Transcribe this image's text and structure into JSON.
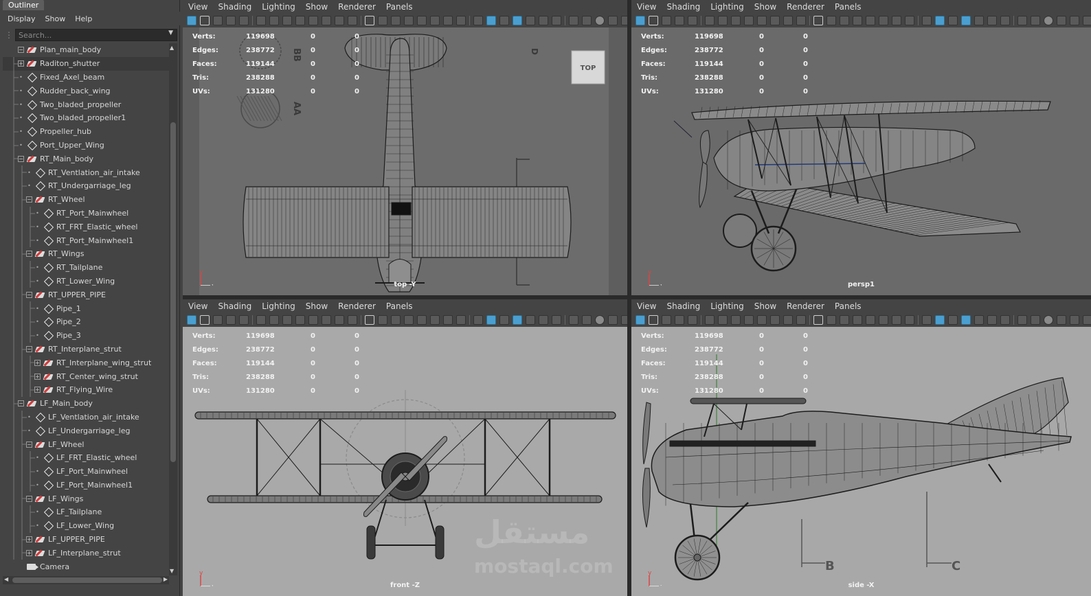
{
  "outliner": {
    "title": "Outliner",
    "menu": [
      "Display",
      "Show",
      "Help"
    ],
    "search_placeholder": "Search...",
    "items": [
      {
        "label": "Plan_main_body",
        "depth": 0,
        "type": "group",
        "expand": "minus"
      },
      {
        "label": "Raditon_shutter",
        "depth": 1,
        "type": "group",
        "expand": "plus",
        "selected": true
      },
      {
        "label": "Fixed_Axel_beam",
        "depth": 1,
        "type": "mesh",
        "expand": "dot"
      },
      {
        "label": "Rudder_back_wing",
        "depth": 1,
        "type": "mesh",
        "expand": "dot"
      },
      {
        "label": "Two_bladed_propeller",
        "depth": 1,
        "type": "mesh",
        "expand": "dot"
      },
      {
        "label": "Two_bladed_propeller1",
        "depth": 1,
        "type": "mesh",
        "expand": "dot"
      },
      {
        "label": "Propeller_hub",
        "depth": 1,
        "type": "mesh",
        "expand": "dot"
      },
      {
        "label": "Port_Upper_Wing",
        "depth": 1,
        "type": "mesh",
        "expand": "dot"
      },
      {
        "label": "RT_Main_body",
        "depth": 1,
        "type": "group",
        "expand": "minus"
      },
      {
        "label": "RT_Ventlation_air_intake",
        "depth": 2,
        "type": "mesh",
        "expand": "dot"
      },
      {
        "label": "RT_Undergarriage_leg",
        "depth": 2,
        "type": "mesh",
        "expand": "dot"
      },
      {
        "label": "RT_Wheel",
        "depth": 2,
        "type": "group",
        "expand": "minus"
      },
      {
        "label": "RT_Port_Mainwheel",
        "depth": 3,
        "type": "mesh",
        "expand": "dot"
      },
      {
        "label": "RT_FRT_Elastic_wheel",
        "depth": 3,
        "type": "mesh",
        "expand": "dot"
      },
      {
        "label": "RT_Port_Mainwheel1",
        "depth": 3,
        "type": "mesh",
        "expand": "dot"
      },
      {
        "label": "RT_Wings",
        "depth": 2,
        "type": "group",
        "expand": "minus"
      },
      {
        "label": "RT_Tailplane",
        "depth": 3,
        "type": "mesh",
        "expand": "dot"
      },
      {
        "label": "RT_Lower_Wing",
        "depth": 3,
        "type": "mesh",
        "expand": "dot"
      },
      {
        "label": "RT_UPPER_PIPE",
        "depth": 2,
        "type": "group",
        "expand": "minus"
      },
      {
        "label": "Pipe_1",
        "depth": 3,
        "type": "mesh",
        "expand": "dot"
      },
      {
        "label": "Pipe_2",
        "depth": 3,
        "type": "mesh",
        "expand": "dot"
      },
      {
        "label": "Pipe_3",
        "depth": 3,
        "type": "mesh",
        "expand": "dot"
      },
      {
        "label": "RT_Interplane_strut",
        "depth": 2,
        "type": "group",
        "expand": "minus"
      },
      {
        "label": "RT_Interplane_wing_strut",
        "depth": 3,
        "type": "group",
        "expand": "plus"
      },
      {
        "label": "RT_Center_wing_strut",
        "depth": 3,
        "type": "group",
        "expand": "plus"
      },
      {
        "label": "RT_Flying_Wire",
        "depth": 3,
        "type": "group",
        "expand": "plus"
      },
      {
        "label": "LF_Main_body",
        "depth": 1,
        "type": "group",
        "expand": "minus"
      },
      {
        "label": "LF_Ventlation_air_intake",
        "depth": 2,
        "type": "mesh",
        "expand": "dot"
      },
      {
        "label": "LF_Undergarriage_leg",
        "depth": 2,
        "type": "mesh",
        "expand": "dot"
      },
      {
        "label": "LF_Wheel",
        "depth": 2,
        "type": "group",
        "expand": "minus"
      },
      {
        "label": "LF_FRT_Elastic_wheel",
        "depth": 3,
        "type": "mesh",
        "expand": "dot"
      },
      {
        "label": "LF_Port_Mainwheel",
        "depth": 3,
        "type": "mesh",
        "expand": "dot"
      },
      {
        "label": "LF_Port_Mainwheel1",
        "depth": 3,
        "type": "mesh",
        "expand": "dot"
      },
      {
        "label": "LF_Wings",
        "depth": 2,
        "type": "group",
        "expand": "minus"
      },
      {
        "label": "LF_Tailplane",
        "depth": 3,
        "type": "mesh",
        "expand": "dot"
      },
      {
        "label": "LF_Lower_Wing",
        "depth": 3,
        "type": "mesh",
        "expand": "dot"
      },
      {
        "label": "LF_UPPER_PIPE",
        "depth": 2,
        "type": "group",
        "expand": "plus"
      },
      {
        "label": "LF_Interplane_strut",
        "depth": 2,
        "type": "group",
        "expand": "plus"
      },
      {
        "label": "Camera",
        "depth": 0,
        "type": "camera",
        "expand": "none"
      }
    ]
  },
  "viewport_menu": [
    "View",
    "Shading",
    "Lighting",
    "Show",
    "Renderer",
    "Panels"
  ],
  "hud": {
    "labels": [
      "Verts:",
      "Edges:",
      "Faces:",
      "Tris:",
      "UVs:"
    ],
    "values": [
      "119698",
      "238772",
      "119144",
      "238288",
      "131280"
    ],
    "zero": "0"
  },
  "viewports": {
    "top": {
      "label": "top -Y",
      "cube": "TOP",
      "axis_a": "y",
      "axis_b": "x"
    },
    "persp": {
      "label": "persp1",
      "axis_a": "y",
      "axis_b": "x"
    },
    "front": {
      "label": "front -Z",
      "field": "0.00",
      "axis_a": "y",
      "axis_b": "x"
    },
    "side": {
      "label": "side -X",
      "axis_a": "y",
      "axis_b": "z"
    }
  },
  "blueprint_marks": {
    "aa": "AA",
    "bb": "BB",
    "b": "B",
    "c": "C",
    "d": "D"
  },
  "watermark": {
    "logo": "مستقل",
    "text": "mostaql.com"
  },
  "colors": {
    "viewport_bg": "#6e6e6e",
    "viewport_bg_dark": "#696969",
    "viewport_bg_light": "#a8a8a8",
    "accent": "#4a9fd0",
    "wire": "#1a1a1a",
    "group_icon_red": "#d03a3a"
  }
}
